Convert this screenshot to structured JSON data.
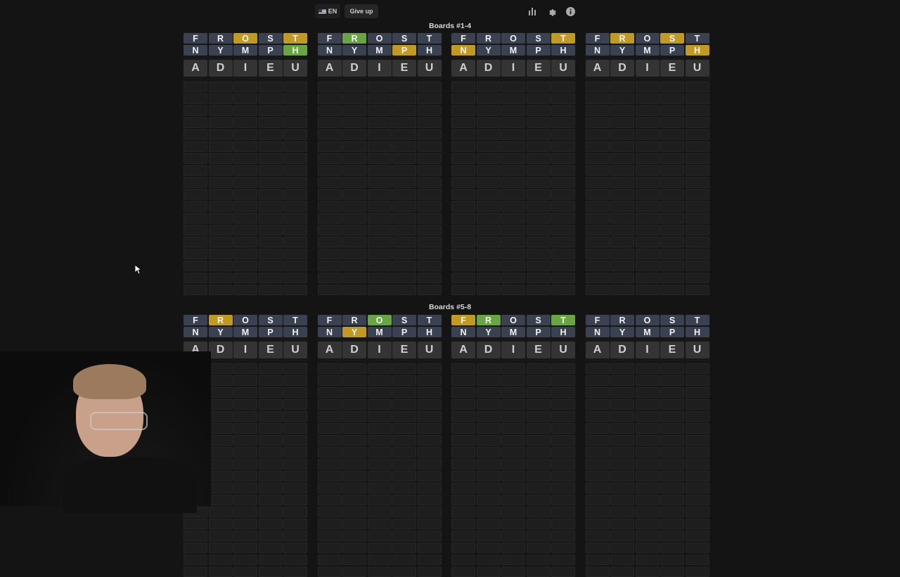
{
  "topbar": {
    "language_label": "EN",
    "giveup_label": "Give up",
    "icons": [
      "flag-us-icon",
      "stats-icon",
      "gear-icon",
      "info-icon"
    ]
  },
  "sections": [
    {
      "title": "Boards #1-4",
      "boards": [
        {
          "rows": [
            [
              [
                "F",
                "n"
              ],
              [
                "R",
                "n"
              ],
              [
                "O",
                "y"
              ],
              [
                "S",
                "n"
              ],
              [
                "T",
                "y"
              ]
            ],
            [
              [
                "N",
                "n"
              ],
              [
                "Y",
                "n"
              ],
              [
                "M",
                "n"
              ],
              [
                "P",
                "n"
              ],
              [
                "H",
                "g"
              ]
            ]
          ]
        },
        {
          "rows": [
            [
              [
                "F",
                "n"
              ],
              [
                "R",
                "g"
              ],
              [
                "O",
                "n"
              ],
              [
                "S",
                "n"
              ],
              [
                "T",
                "n"
              ]
            ],
            [
              [
                "N",
                "n"
              ],
              [
                "Y",
                "n"
              ],
              [
                "M",
                "n"
              ],
              [
                "P",
                "y"
              ],
              [
                "H",
                "n"
              ]
            ]
          ]
        },
        {
          "rows": [
            [
              [
                "F",
                "n"
              ],
              [
                "R",
                "n"
              ],
              [
                "O",
                "n"
              ],
              [
                "S",
                "n"
              ],
              [
                "T",
                "y"
              ]
            ],
            [
              [
                "N",
                "y"
              ],
              [
                "Y",
                "n"
              ],
              [
                "M",
                "n"
              ],
              [
                "P",
                "n"
              ],
              [
                "H",
                "n"
              ]
            ]
          ]
        },
        {
          "rows": [
            [
              [
                "F",
                "n"
              ],
              [
                "R",
                "y"
              ],
              [
                "O",
                "n"
              ],
              [
                "S",
                "y"
              ],
              [
                "T",
                "n"
              ]
            ],
            [
              [
                "N",
                "n"
              ],
              [
                "Y",
                "n"
              ],
              [
                "M",
                "n"
              ],
              [
                "P",
                "n"
              ],
              [
                "H",
                "y"
              ]
            ]
          ]
        }
      ]
    },
    {
      "title": "Boards #5-8",
      "boards": [
        {
          "rows": [
            [
              [
                "F",
                "n"
              ],
              [
                "R",
                "y"
              ],
              [
                "O",
                "n"
              ],
              [
                "S",
                "n"
              ],
              [
                "T",
                "n"
              ]
            ],
            [
              [
                "N",
                "n"
              ],
              [
                "Y",
                "n"
              ],
              [
                "M",
                "n"
              ],
              [
                "P",
                "n"
              ],
              [
                "H",
                "n"
              ]
            ]
          ]
        },
        {
          "rows": [
            [
              [
                "F",
                "n"
              ],
              [
                "R",
                "n"
              ],
              [
                "O",
                "g"
              ],
              [
                "S",
                "n"
              ],
              [
                "T",
                "n"
              ]
            ],
            [
              [
                "N",
                "n"
              ],
              [
                "Y",
                "y"
              ],
              [
                "M",
                "n"
              ],
              [
                "P",
                "n"
              ],
              [
                "H",
                "n"
              ]
            ]
          ]
        },
        {
          "rows": [
            [
              [
                "F",
                "y"
              ],
              [
                "R",
                "g"
              ],
              [
                "O",
                "n"
              ],
              [
                "S",
                "n"
              ],
              [
                "T",
                "g"
              ]
            ],
            [
              [
                "N",
                "n"
              ],
              [
                "Y",
                "n"
              ],
              [
                "M",
                "n"
              ],
              [
                "P",
                "n"
              ],
              [
                "H",
                "n"
              ]
            ]
          ]
        },
        {
          "rows": [
            [
              [
                "F",
                "n"
              ],
              [
                "R",
                "n"
              ],
              [
                "O",
                "n"
              ],
              [
                "S",
                "n"
              ],
              [
                "T",
                "n"
              ]
            ],
            [
              [
                "N",
                "n"
              ],
              [
                "Y",
                "n"
              ],
              [
                "M",
                "n"
              ],
              [
                "P",
                "n"
              ],
              [
                "H",
                "n"
              ]
            ]
          ]
        }
      ]
    }
  ],
  "current_guess": [
    "A",
    "D",
    "I",
    "E",
    "U"
  ],
  "colors": {
    "green": "#6aa544",
    "yellow": "#c19a24",
    "neutral": "#3a4150",
    "background": "#141414"
  }
}
